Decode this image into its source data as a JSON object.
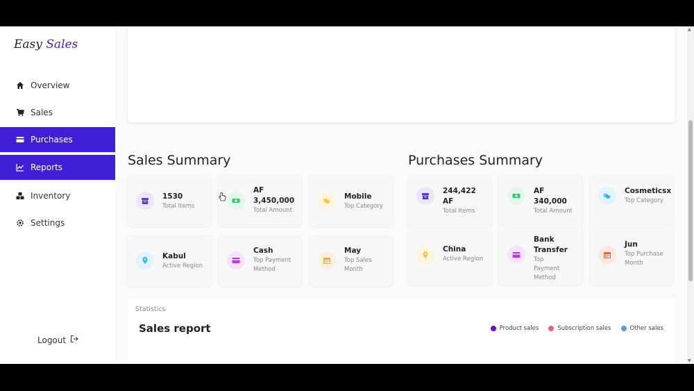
{
  "app": {
    "logo_main": "Easy ",
    "logo_accent": "Sales"
  },
  "sidebar": {
    "items": [
      {
        "label": "Overview",
        "icon": "home-icon"
      },
      {
        "label": "Sales",
        "icon": "cart-icon"
      },
      {
        "label": "Purchases",
        "icon": "credit-card-icon"
      },
      {
        "label": "Reports",
        "icon": "chart-icon"
      },
      {
        "label": "Inventory",
        "icon": "boxes-icon"
      },
      {
        "label": "Settings",
        "icon": "gear-icon"
      }
    ],
    "logout_label": "Logout"
  },
  "sales_summary": {
    "title": "Sales Summary",
    "cards": [
      {
        "value": "1530",
        "label": "Total Items",
        "icon": "box-icon",
        "color": "#5b3cc4"
      },
      {
        "value": "AF 3,450,000",
        "label": "Total Amount",
        "icon": "money-icon",
        "color": "#2ecc71"
      },
      {
        "value": "Mobile",
        "label": "Top Category",
        "icon": "tag-icon",
        "color": "#f5c242"
      },
      {
        "value": "Kabul",
        "label": "Active Region",
        "icon": "location-icon",
        "color": "#29b6f6"
      },
      {
        "value": "Cash",
        "label": "Top Payment Method",
        "icon": "card-icon",
        "color": "#b43ce0"
      },
      {
        "value": "May",
        "label": "Top Sales Month",
        "icon": "calendar-icon",
        "color": "#f5a623"
      }
    ]
  },
  "purchases_summary": {
    "title": "Purchases Summary",
    "cards": [
      {
        "value": "244,422 AF",
        "label": "Total Items",
        "icon": "box-icon",
        "color": "#5b3cc4"
      },
      {
        "value": "AF 340,000",
        "label": "Total Amount",
        "icon": "money-icon",
        "color": "#2ecc71"
      },
      {
        "value": "Cosmeticsx",
        "label": "Top Category",
        "icon": "tag-icon",
        "color": "#29b6f6"
      },
      {
        "value": "China",
        "label": "Active Region",
        "icon": "location-icon",
        "color": "#f5c242"
      },
      {
        "value": "Bank Transfer",
        "label": "Top Payment Method",
        "icon": "card-icon",
        "color": "#b43ce0"
      },
      {
        "value": "Jun",
        "label": "Top Purchase Month",
        "icon": "calendar-icon",
        "color": "#f0612f"
      }
    ]
  },
  "statistics": {
    "label": "Statistics",
    "title": "Sales report",
    "legend": [
      {
        "label": "Product sales",
        "color": "#6a0dce"
      },
      {
        "label": "Subscription sales",
        "color": "#e8607a"
      },
      {
        "label": "Other sales",
        "color": "#5b9bd5"
      }
    ]
  }
}
